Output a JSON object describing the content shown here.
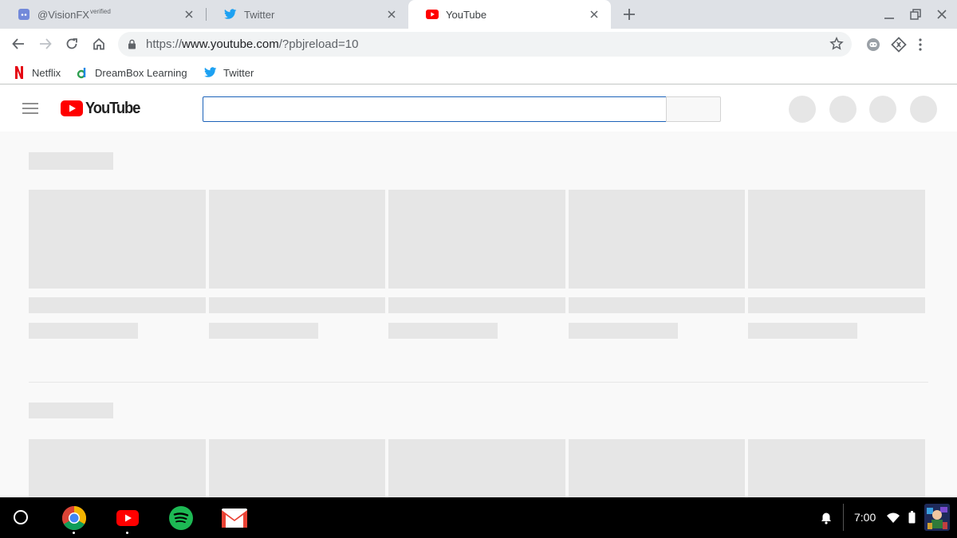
{
  "tabs": [
    {
      "label": "@VisionFX",
      "superscript": "verified",
      "icon": "discord-icon",
      "active": false
    },
    {
      "label": "Twitter",
      "icon": "twitter-icon",
      "active": false
    },
    {
      "label": "YouTube",
      "icon": "youtube-icon",
      "active": true
    }
  ],
  "toolbar": {
    "url_scheme": "https://",
    "url_host": "www.youtube.com",
    "url_path": "/?pbjreload=10"
  },
  "bookmarks": [
    {
      "label": "Netflix",
      "icon": "netflix-icon"
    },
    {
      "label": "DreamBox Learning",
      "icon": "dreambox-icon"
    },
    {
      "label": "Twitter",
      "icon": "twitter-icon"
    }
  ],
  "youtube": {
    "logo_text": "YouTube",
    "search_value": "",
    "brand_color": "#ff0000",
    "loading": true
  },
  "shelf": {
    "apps": [
      "chrome-icon",
      "youtube-icon",
      "spotify-icon",
      "gmail-icon"
    ],
    "time": "7:00"
  },
  "colors": {
    "tabstrip_bg": "#dee1e6",
    "placeholder_gray": "#e6e6e6",
    "page_bg": "#f9f9f9",
    "search_focus": "#1c62b9",
    "twitter_blue": "#1da1f2",
    "spotify_green": "#1db954"
  }
}
